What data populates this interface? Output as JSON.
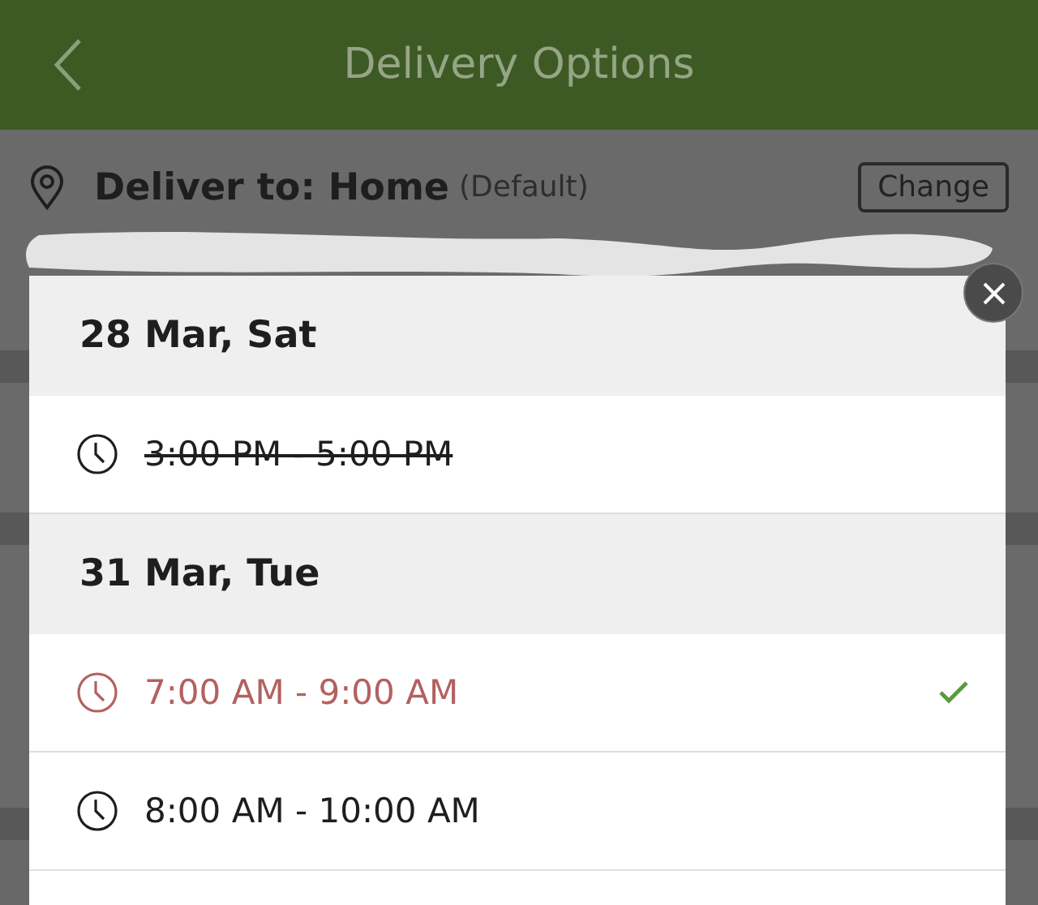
{
  "header": {
    "title": "Delivery Options"
  },
  "address": {
    "label": "Deliver to: Home",
    "note": "(Default)",
    "button": "Change"
  },
  "slot_picker": {
    "days": [
      {
        "date": "28 Mar, Sat",
        "slots": [
          {
            "time": "3:00 PM - 5:00 PM",
            "disabled": true,
            "selected": false
          }
        ]
      },
      {
        "date": "31 Mar, Tue",
        "slots": [
          {
            "time": "7:00 AM - 9:00 AM",
            "disabled": false,
            "selected": true
          },
          {
            "time": "8:00 AM - 10:00 AM",
            "disabled": false,
            "selected": false
          }
        ]
      }
    ]
  }
}
